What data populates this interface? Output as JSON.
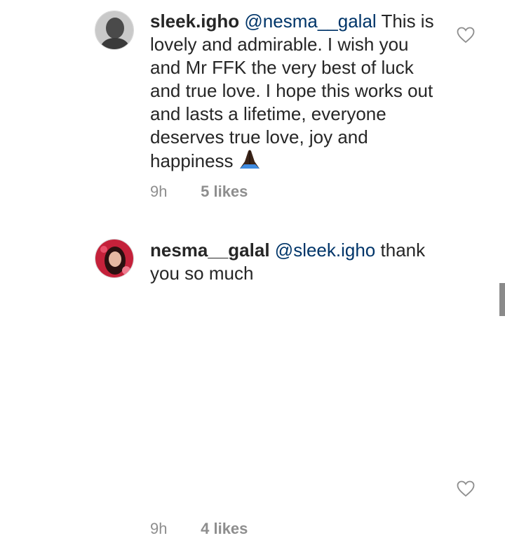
{
  "comments": [
    {
      "username": "sleek.igho",
      "mention": "@nesma__galal",
      "text": "This is lovely and admirable. I wish you and Mr FFK the very best of luck and true love. I hope this works out and lasts a lifetime, everyone deserves true love, joy and happiness",
      "emoji": "praying-hands-icon",
      "time": "9h",
      "likes": "5 likes"
    },
    {
      "username": "nesma__galal",
      "mention": "@sleek.igho",
      "text": "thank you so much",
      "time": "9h",
      "likes": "4 likes"
    }
  ],
  "colors": {
    "text": "#262626",
    "mention": "#003569",
    "meta": "#8e8e8e"
  }
}
